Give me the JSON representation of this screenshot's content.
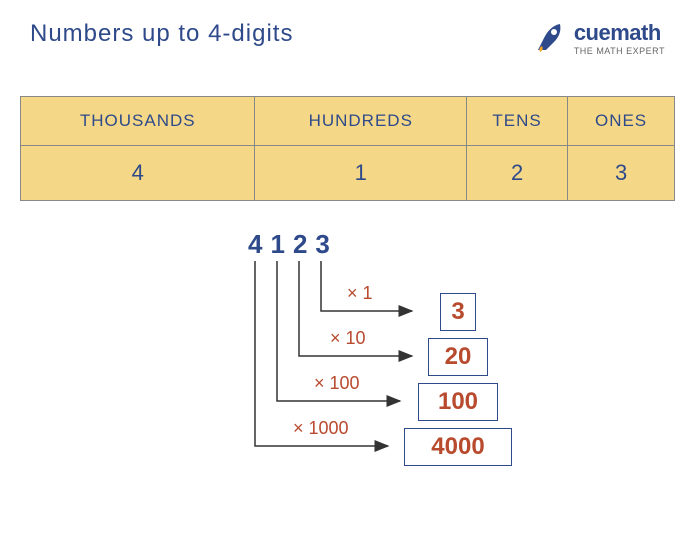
{
  "title": "Numbers up to 4-digits",
  "logo": {
    "name": "cuemath",
    "tagline": "THE MATH EXPERT"
  },
  "table": {
    "headers": [
      "THOUSANDS",
      "HUNDREDS",
      "TENS",
      "ONES"
    ],
    "values": [
      "4",
      "1",
      "2",
      "3"
    ]
  },
  "diagram": {
    "digits": [
      "4",
      "1",
      "2",
      "3"
    ],
    "rows": [
      {
        "mult": "× 1",
        "result": "3"
      },
      {
        "mult": "× 10",
        "result": "20"
      },
      {
        "mult": "× 100",
        "result": "100"
      },
      {
        "mult": "× 1000",
        "result": "4000"
      }
    ]
  },
  "chart_data": {
    "type": "table",
    "title": "Numbers up to 4-digits",
    "number": 4123,
    "place_values": [
      {
        "place": "THOUSANDS",
        "digit": 4,
        "multiplier": 1000,
        "value": 4000
      },
      {
        "place": "HUNDREDS",
        "digit": 1,
        "multiplier": 100,
        "value": 100
      },
      {
        "place": "TENS",
        "digit": 2,
        "multiplier": 10,
        "value": 20
      },
      {
        "place": "ONES",
        "digit": 3,
        "multiplier": 1,
        "value": 3
      }
    ]
  }
}
